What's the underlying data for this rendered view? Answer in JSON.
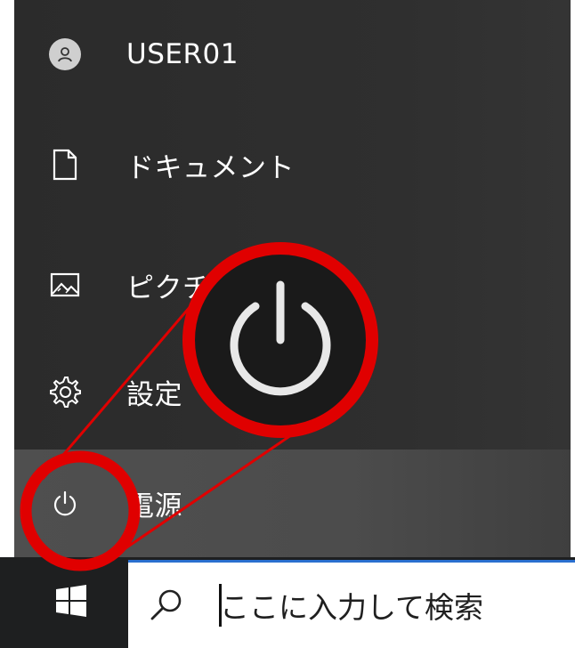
{
  "start_menu": {
    "items": [
      {
        "label": "USER01",
        "icon": "user-avatar-icon"
      },
      {
        "label": "ドキュメント",
        "icon": "document-icon"
      },
      {
        "label": "ピクチャ",
        "icon": "picture-icon"
      },
      {
        "label": "設定",
        "icon": "gear-icon"
      },
      {
        "label": "電源",
        "icon": "power-icon"
      }
    ]
  },
  "taskbar": {
    "start_icon": "windows-logo-icon",
    "search": {
      "placeholder": "ここに入力して検索",
      "icon": "search-icon",
      "accent_color": "#2a6fcf"
    }
  },
  "annotation": {
    "highlight_color": "#e00000",
    "zoomed_icon": "power-icon"
  },
  "colors": {
    "menu_background": "#2b2b2b",
    "hover_background": "#4f4f4f",
    "taskbar_background": "#1e1f20"
  }
}
